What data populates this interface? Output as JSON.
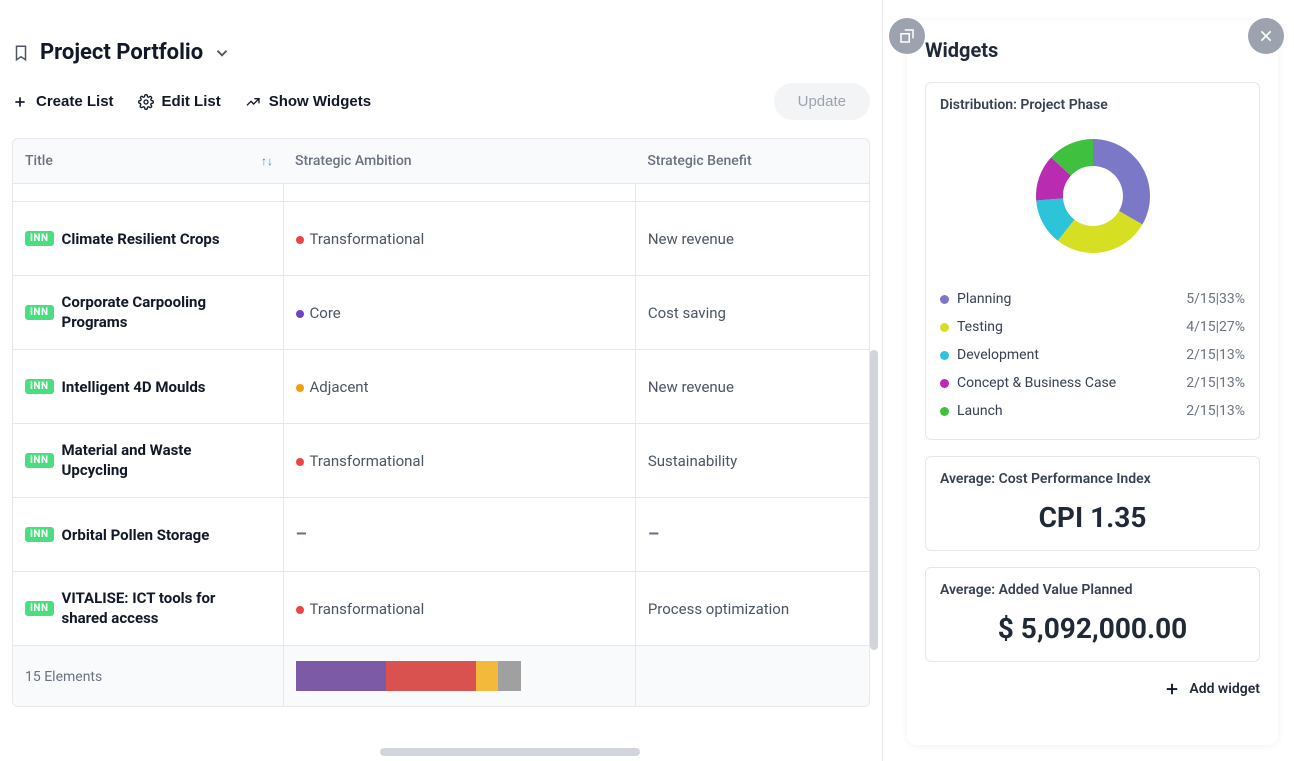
{
  "header": {
    "title": "Project Portfolio"
  },
  "toolbar": {
    "create_list": "Create List",
    "edit_list": "Edit List",
    "show_widgets": "Show Widgets",
    "update": "Update"
  },
  "table": {
    "columns": {
      "title": "Title",
      "ambition": "Strategic Ambition",
      "benefit": "Strategic Benefit"
    },
    "rows": [
      {
        "badge": "INN",
        "title": "Climate Resilient Crops",
        "ambition": "Transformational",
        "ambitionColor": "dot-red",
        "benefit": "New revenue"
      },
      {
        "badge": "INN",
        "title": "Corporate Carpooling Programs",
        "ambition": "Core",
        "ambitionColor": "dot-purple",
        "benefit": "Cost saving"
      },
      {
        "badge": "INN",
        "title": "Intelligent 4D Moulds",
        "ambition": "Adjacent",
        "ambitionColor": "dot-yellow",
        "benefit": "New revenue"
      },
      {
        "badge": "INN",
        "title": "Material and Waste Upcycling",
        "ambition": "Transformational",
        "ambitionColor": "dot-red",
        "benefit": "Sustainability"
      },
      {
        "badge": "INN",
        "title": "Orbital Pollen Storage",
        "ambition": "–",
        "ambitionColor": "",
        "benefit": "–"
      },
      {
        "badge": "INN",
        "title": "VITALISE: ICT tools for shared access",
        "ambition": "Transformational",
        "ambitionColor": "dot-red",
        "benefit": "Process optimization"
      }
    ],
    "footer_count": "15 Elements"
  },
  "panel": {
    "title": "Widgets",
    "add_widget": "Add widget",
    "distribution": {
      "title": "Distribution: Project Phase",
      "items": [
        {
          "label": "Planning",
          "value": "5/15|33%",
          "color": "#7b79c7"
        },
        {
          "label": "Testing",
          "value": "4/15|27%",
          "color": "#d7df23"
        },
        {
          "label": "Development",
          "value": "2/15|13%",
          "color": "#2bc4d8"
        },
        {
          "label": "Concept & Business Case",
          "value": "2/15|13%",
          "color": "#b92bb0"
        },
        {
          "label": "Launch",
          "value": "2/15|13%",
          "color": "#3fc13f"
        }
      ]
    },
    "cpi": {
      "title": "Average: Cost Performance Index",
      "value": "CPI 1.35"
    },
    "added_value": {
      "title": "Average: Added Value Planned",
      "value": "$ 5,092,000.00"
    }
  },
  "chart_data": {
    "type": "pie",
    "title": "Distribution: Project Phase",
    "series": [
      {
        "name": "Planning",
        "count": 5,
        "total": 15,
        "percent": 33,
        "color": "#7b79c7"
      },
      {
        "name": "Testing",
        "count": 4,
        "total": 15,
        "percent": 27,
        "color": "#d7df23"
      },
      {
        "name": "Development",
        "count": 2,
        "total": 15,
        "percent": 13,
        "color": "#2bc4d8"
      },
      {
        "name": "Concept & Business Case",
        "count": 2,
        "total": 15,
        "percent": 13,
        "color": "#b92bb0"
      },
      {
        "name": "Launch",
        "count": 2,
        "total": 15,
        "percent": 13,
        "color": "#3fc13f"
      }
    ]
  }
}
